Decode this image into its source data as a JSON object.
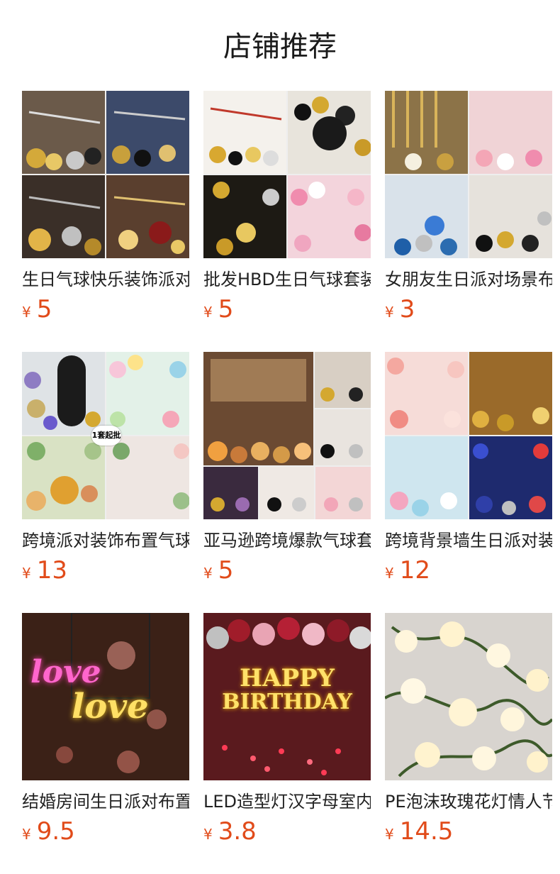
{
  "page": {
    "title": "店铺推荐"
  },
  "products": [
    {
      "name": "生日气球快乐装饰派对",
      "currency": "¥",
      "price": "5"
    },
    {
      "name": "批发HBD生日气球套装",
      "currency": "¥",
      "price": "5"
    },
    {
      "name": "女朋友生日派对场景布置",
      "currency": "¥",
      "price": "3"
    },
    {
      "name": "跨境派对装饰布置气球",
      "currency": "¥",
      "price": "13",
      "badge": "1套起批"
    },
    {
      "name": "亚马逊跨境爆款气球套装",
      "currency": "¥",
      "price": "5"
    },
    {
      "name": "跨境背景墙生日派对装饰",
      "currency": "¥",
      "price": "12"
    },
    {
      "name": "结婚房间生日派对布置灯",
      "currency": "¥",
      "price": "9.5",
      "image_text": [
        "love",
        "love"
      ]
    },
    {
      "name": "LED造型灯汉字母室内装饰",
      "currency": "¥",
      "price": "3.8",
      "image_text": [
        "HAPPY",
        "BIRTHDAY"
      ]
    },
    {
      "name": "PE泡沫玫瑰花灯情人节",
      "currency": "¥",
      "price": "14.5"
    }
  ],
  "colors": {
    "price": "#e14b1a",
    "title": "#1a1a1a",
    "name": "#222222"
  }
}
